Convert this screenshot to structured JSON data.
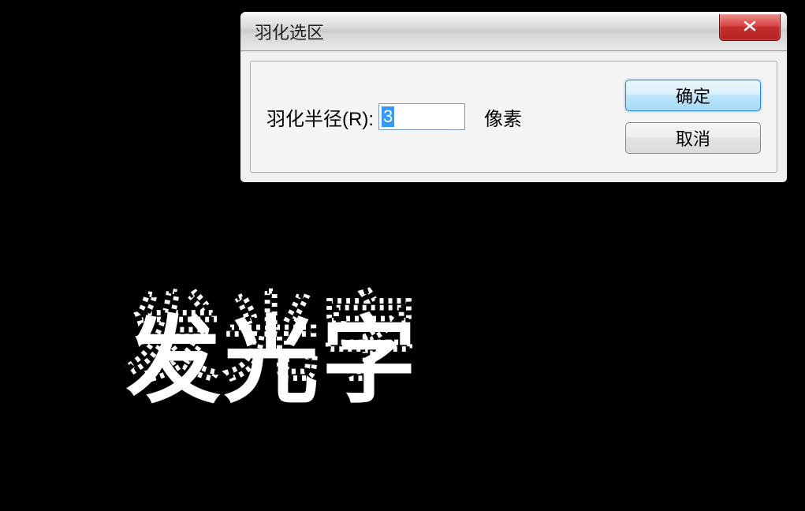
{
  "canvas": {
    "text": "发光字"
  },
  "dialog": {
    "title": "羽化选区",
    "radius_label": "羽化半径(R):",
    "radius_value": "3",
    "unit": "像素",
    "ok_label": "确定",
    "cancel_label": "取消"
  }
}
